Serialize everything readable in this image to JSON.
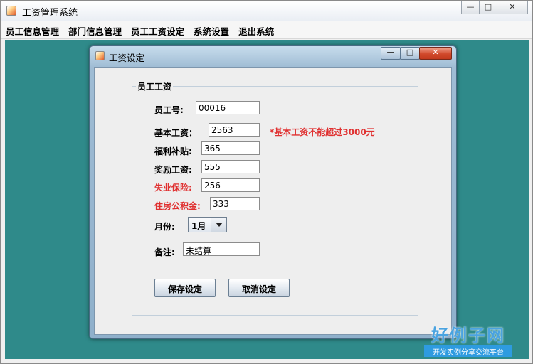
{
  "window": {
    "title": "工资管理系统",
    "minimize": "—",
    "maximize": "□",
    "close": "✕"
  },
  "menu": {
    "items": [
      {
        "label": "员工信息管理"
      },
      {
        "label": "部门信息管理"
      },
      {
        "label": "员工工资设定"
      },
      {
        "label": "系统设置"
      },
      {
        "label": "退出系统"
      }
    ]
  },
  "dialog": {
    "title": "工资设定",
    "minimize": "—",
    "maximize": "□",
    "close": "✕",
    "group_title": "员工工资",
    "employee_id": {
      "label": "员工号:",
      "value": "00016"
    },
    "base_salary": {
      "label": "基本工资：",
      "value": "2563",
      "warning": "*基本工资不能超过3000元"
    },
    "welfare": {
      "label": "福利补贴:",
      "value": "365"
    },
    "bonus": {
      "label": "奖励工资:",
      "value": "555"
    },
    "unemployment": {
      "label": "失业保险:",
      "value": "256"
    },
    "housing_fund": {
      "label": "住房公积金:",
      "value": "333"
    },
    "month": {
      "label": "月份:",
      "value": "1月"
    },
    "remark": {
      "label": "备注:",
      "value": "未结算"
    },
    "save_button": "保存设定",
    "cancel_button": "取消设定"
  },
  "watermark": {
    "logo_title": "好例子网",
    "logo_subtitle": "开发实例分享交流平台"
  },
  "colors": {
    "desktop": "#2f8a8a",
    "warning": "#e03030",
    "accent": "#2e9be0"
  },
  "icons": [
    "java-cup-icon",
    "minimize-icon",
    "maximize-icon",
    "close-icon",
    "dropdown-arrow-icon"
  ]
}
